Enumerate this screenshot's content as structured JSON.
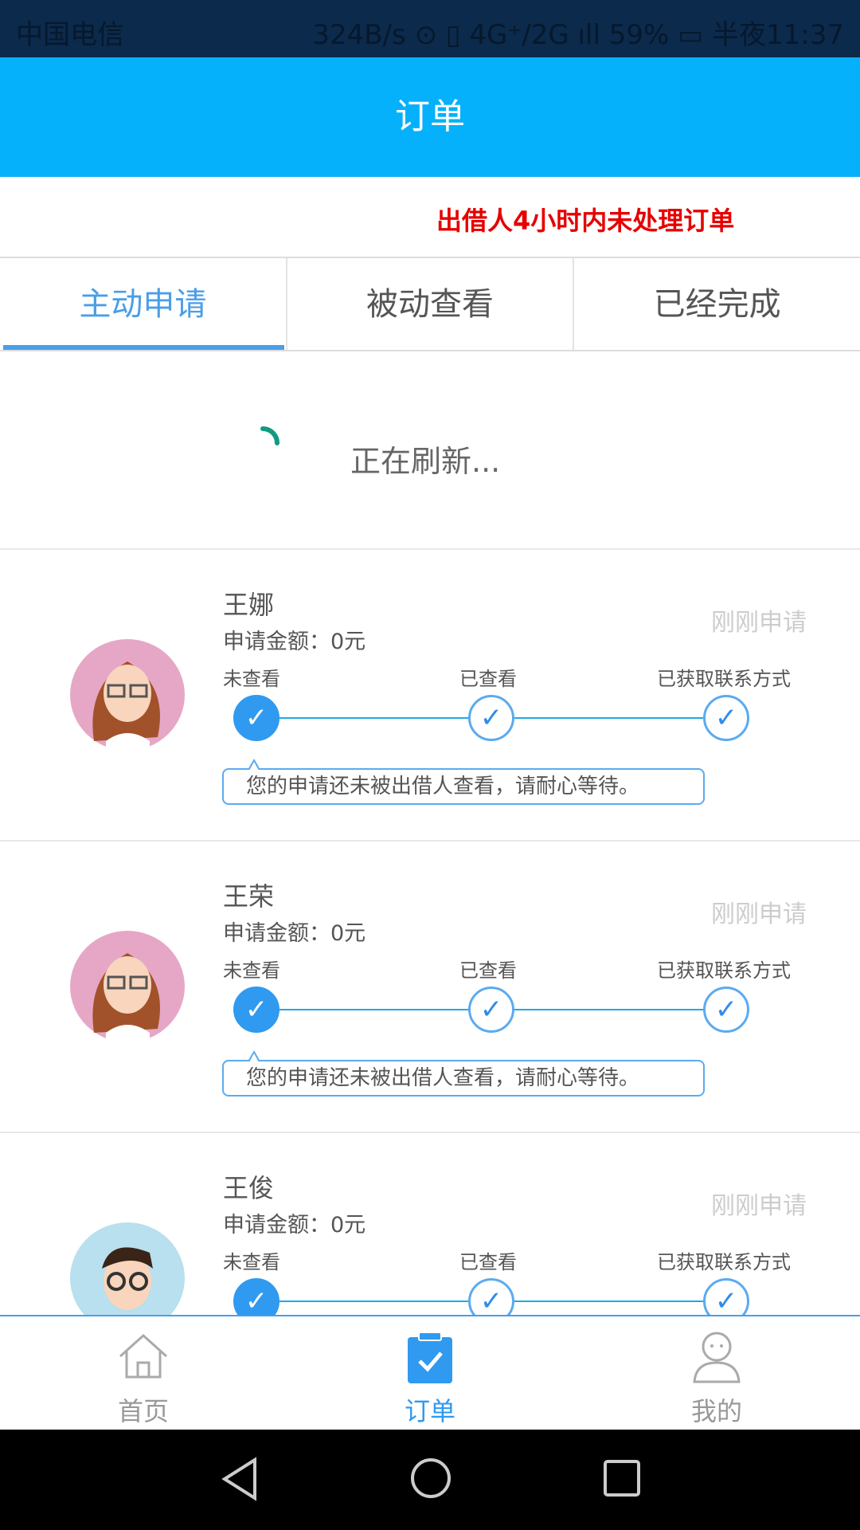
{
  "status_bar": {
    "carrier": "中国电信",
    "right": "324B/s ⊙ ▯ 4G⁺/2G ıll 59% ▭ 半夜11:37"
  },
  "header": {
    "title": "订单"
  },
  "marquee": {
    "text": "出借人4小时内未处理订单"
  },
  "tabs": [
    {
      "label": "主动申请",
      "active": true
    },
    {
      "label": "被动查看"
    },
    {
      "label": "已经完成"
    }
  ],
  "refresh": {
    "text": "正在刷新..."
  },
  "steps": [
    "未查看",
    "已查看",
    "已获取联系方式"
  ],
  "cards": [
    {
      "name": "王娜",
      "amount": "申请金额：0元",
      "time": "刚刚申请",
      "message": "您的申请还未被出借人查看，请耐心等待。",
      "avatar": "female"
    },
    {
      "name": "王荣",
      "amount": "申请金额：0元",
      "time": "刚刚申请",
      "message": "您的申请还未被出借人查看，请耐心等待。",
      "avatar": "female"
    },
    {
      "name": "王俊",
      "amount": "申请金额：0元",
      "time": "刚刚申请",
      "message": "",
      "avatar": "male"
    }
  ],
  "bottom_nav": [
    {
      "label": "首页",
      "icon": "home-icon"
    },
    {
      "label": "订单",
      "icon": "clipboard-check-icon",
      "active": true
    },
    {
      "label": "我的",
      "icon": "user-icon"
    }
  ],
  "colors": {
    "header": "#05b1fb",
    "accent": "#2f9af0",
    "marquee": "#e60000"
  }
}
